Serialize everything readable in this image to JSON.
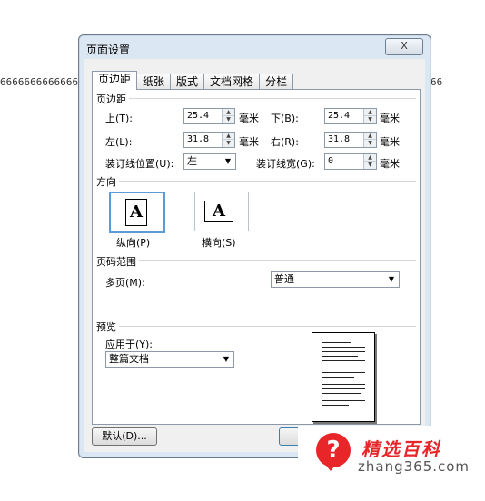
{
  "background": {
    "text_left": "6666666666666",
    "text_right": "66"
  },
  "dialog": {
    "title": "页面设置",
    "close_label": "X",
    "tabs": [
      {
        "label": "页边距",
        "active": true
      },
      {
        "label": "纸张",
        "active": false
      },
      {
        "label": "版式",
        "active": false
      },
      {
        "label": "文档网格",
        "active": false
      },
      {
        "label": "分栏",
        "active": false
      }
    ],
    "margins": {
      "section_label": "页边距",
      "top": {
        "label": "上(T):",
        "value": "25.4",
        "unit": "毫米"
      },
      "bottom": {
        "label": "下(B):",
        "value": "25.4",
        "unit": "毫米"
      },
      "left": {
        "label": "左(L):",
        "value": "31.8",
        "unit": "毫米"
      },
      "right": {
        "label": "右(R):",
        "value": "31.8",
        "unit": "毫米"
      },
      "gutter_pos": {
        "label": "装订线位置(U):",
        "value": "左"
      },
      "gutter": {
        "label": "装订线宽(G):",
        "value": "0",
        "unit": "毫米"
      }
    },
    "orientation": {
      "section_label": "方向",
      "portrait": {
        "label": "纵向(P)",
        "glyph": "A",
        "selected": true
      },
      "landscape": {
        "label": "横向(S)",
        "glyph": "A",
        "selected": false
      }
    },
    "pages": {
      "section_label": "页码范围",
      "multiple_label": "多页(M):",
      "multiple_value": "普通"
    },
    "preview": {
      "section_label": "预览",
      "apply_label": "应用于(Y):",
      "apply_value": "整篇文档"
    },
    "buttons": {
      "default_label": "默认(D)..."
    }
  },
  "watermark": {
    "brand": "精选百科",
    "site": "zhang365.com",
    "icon": "question-mark-icon",
    "accent": "#e8262a"
  }
}
